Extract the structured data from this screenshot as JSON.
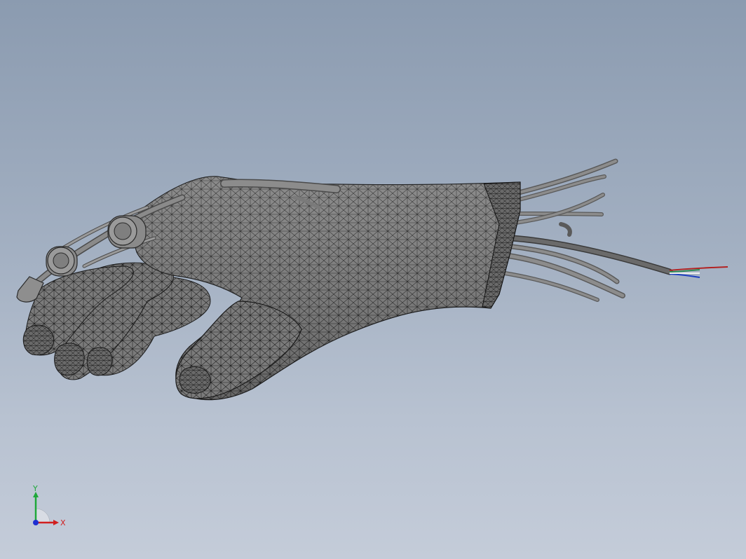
{
  "viewport": {
    "background_top": "#8b9bb0",
    "background_bottom": "#c4ccd9"
  },
  "model": {
    "name": "glove-wireframe-model",
    "mesh_color": "#7a7a7a",
    "edge_color": "#1a1a1a",
    "cable_color": "#6e6e6e",
    "wire_colors": [
      "#b22222",
      "#2e8b57",
      "#1e3fbf",
      "#f0f0f0"
    ]
  },
  "triad": {
    "x_label": "X",
    "y_label": "Y",
    "x_color": "#d11f1f",
    "y_color": "#1fa83a",
    "z_color": "#1f2fd1"
  }
}
